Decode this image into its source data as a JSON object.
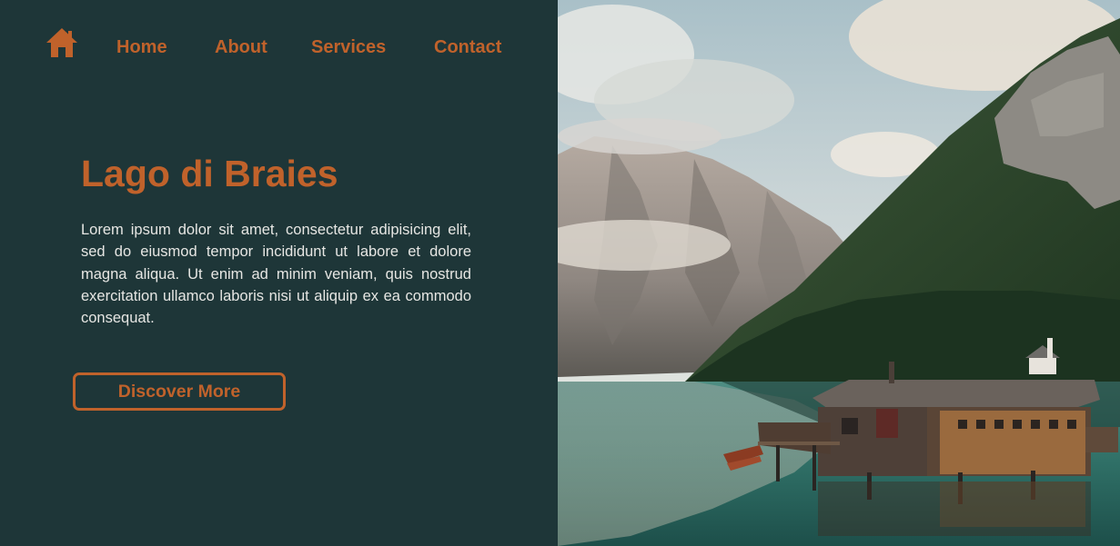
{
  "nav": {
    "home_icon": "home-icon",
    "links": [
      {
        "label": "Home"
      },
      {
        "label": "About"
      },
      {
        "label": "Services"
      },
      {
        "label": "Contact"
      }
    ]
  },
  "hero": {
    "title": "Lago di Braies",
    "body": "Lorem ipsum dolor sit amet, consectetur adipisicing elit, sed do eiusmod tempor incididunt ut labore et dolore magna aliqua. Ut enim ad minim veniam, quis nostrud exercitation ullamco laboris nisi ut aliquip ex ea commodo consequat.",
    "button_label": "Discover More"
  },
  "colors": {
    "background": "#1e3638",
    "accent": "#c0622b",
    "body_text": "#e6e6e3"
  }
}
